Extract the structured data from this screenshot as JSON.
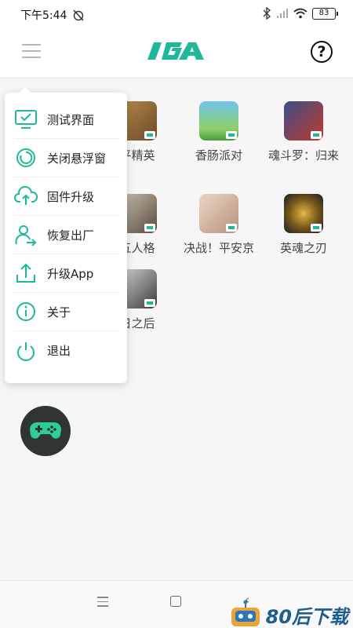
{
  "status_bar": {
    "time": "下午5:44",
    "battery": "83"
  },
  "header": {
    "logo_text": "IGA",
    "help_label": "?"
  },
  "menu": {
    "items": [
      {
        "label": "测试界面",
        "icon": "monitor-check-icon"
      },
      {
        "label": "关闭悬浮窗",
        "icon": "float-window-icon"
      },
      {
        "label": "固件升级",
        "icon": "cloud-upload-icon"
      },
      {
        "label": "恢复出厂",
        "icon": "user-reset-icon"
      },
      {
        "label": "升级App",
        "icon": "upload-icon"
      },
      {
        "label": "关于",
        "icon": "info-icon"
      },
      {
        "label": "退出",
        "icon": "power-icon"
      }
    ]
  },
  "games": [
    {
      "name": "平精英",
      "icon": "game-icon"
    },
    {
      "name": "香肠派对",
      "icon": "game-icon"
    },
    {
      "name": "魂斗罗：归来",
      "icon": "game-icon"
    },
    {
      "name": "五人格",
      "icon": "game-icon"
    },
    {
      "name": "决战！平安京",
      "icon": "game-icon"
    },
    {
      "name": "英魂之刃",
      "icon": "game-icon"
    },
    {
      "name": "日之后",
      "icon": "game-icon"
    }
  ],
  "watermark": {
    "text": "80后下载"
  },
  "colors": {
    "accent": "#1fb89a",
    "fab": "#2f3531",
    "watermark": "#1f5e8c"
  }
}
